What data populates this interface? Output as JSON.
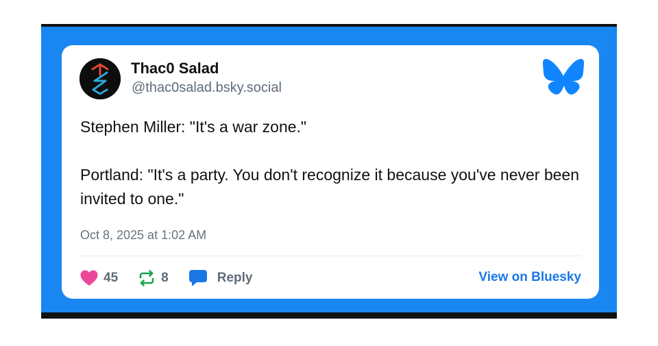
{
  "post": {
    "author": {
      "display_name": "Thac0 Salad",
      "handle": "@thac0salad.bsky.social",
      "avatar_icon": "rune-symbol-icon"
    },
    "platform_icon": "bluesky-butterfly-icon",
    "text_paragraphs": [
      "Stephen Miller: \"It's a war zone.\"",
      "Portland: \"It's a party. You don't recognize it because you've never been invited to one.\""
    ],
    "timestamp": "Oct 8, 2025 at 1:02 AM",
    "actions": {
      "likes": "45",
      "reposts": "8",
      "reply_label": "Reply",
      "view_link_label": "View on Bluesky"
    }
  },
  "colors": {
    "frame_blue": "#1a86f2",
    "card_background": "#ffffff",
    "like_pink": "#ec4899",
    "repost_green": "#16a34a",
    "reply_blue": "#1a78e6",
    "link_blue": "#1a78e6",
    "muted_text": "#5f6b78"
  }
}
